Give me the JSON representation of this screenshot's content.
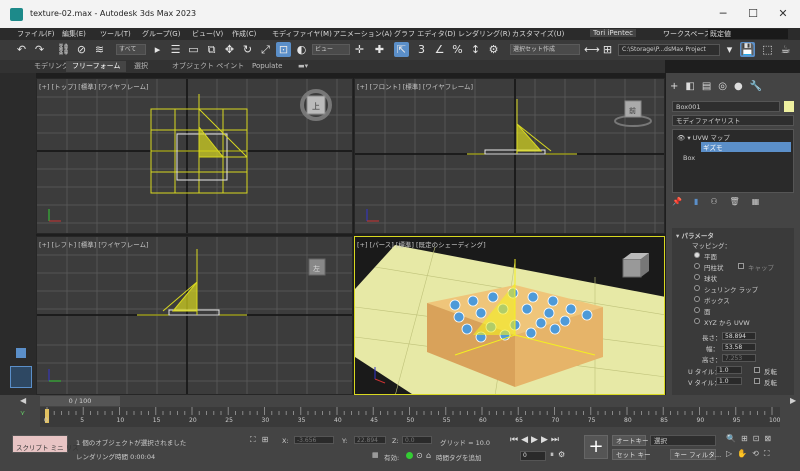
{
  "window": {
    "title": "texture-02.max - Autodesk 3ds Max 2023",
    "min_icon": "minimize-icon",
    "max_icon": "maximize-icon",
    "close_icon": "close-icon"
  },
  "menu": [
    "ファイル(F)",
    "編集(E)",
    "ツール(T)",
    "グループ(G)",
    "ビュー(V)",
    "作成(C)",
    "モディファイヤ(M)",
    "アニメーション(A)",
    "グラフ エディタ(D)",
    "レンダリング(R)",
    "カスタマイズ(U)"
  ],
  "user": {
    "name": "Tori iPentec",
    "workspace_label": "ワークスペース:",
    "workspace_value": "既定値"
  },
  "toolbar": {
    "selection_filter": "すべて",
    "ref_coord": "ビュー",
    "named_sel": "選択セット作成",
    "project_path": "C:\\Storage\\P...dsMax Project"
  },
  "ribbon_tabs": [
    "モデリング",
    "フリーフォーム",
    "選択",
    "オブジェクト ペイント",
    "Populate"
  ],
  "viewports": {
    "top": "[+] [トップ] [標準] [ワイヤフレーム]",
    "front": "[+] [フロント] [標準] [ワイヤフレーム]",
    "left": "[+] [レフト] [標準] [ワイヤフレーム]",
    "persp": "[+] [パース] [標準] [既定のシェーディング]",
    "cube_top": "上",
    "cube_front": "前",
    "cube_left": "左"
  },
  "command_panel": {
    "object_name": "Box001",
    "modifier_list": "モディファイヤリスト",
    "stack": [
      "UVW マップ",
      "ギズモ",
      "Box"
    ],
    "rollout": "パラメータ",
    "mapping_label": "マッピング：",
    "mapping_options": [
      "平面",
      "円柱状",
      "球状",
      "シュリンク ラップ",
      "ボックス",
      "面",
      "XYZ から UVW"
    ],
    "cap_label": "キャップ",
    "length_label": "長さ：",
    "length": "58.894",
    "width_label": "幅：",
    "width": "53.58",
    "height_label": "高さ：",
    "height": "7.253",
    "u_tile_label": "U タイル：",
    "u_tile": "1.0",
    "v_tile_label": "V タイル：",
    "v_tile": "1.0",
    "flip_label": "反転"
  },
  "timeline": {
    "frame": "0 / 100",
    "ticks": [
      "0",
      "5",
      "10",
      "15",
      "20",
      "25",
      "30",
      "35",
      "40",
      "45",
      "50",
      "55",
      "60",
      "65",
      "70",
      "75",
      "80",
      "85",
      "90",
      "95",
      "100"
    ]
  },
  "status": {
    "script_label": "スクリプト ミニ リス",
    "message": "1 個のオブジェクトが選択されました",
    "render_time": "レンダリング時間  0:00:04",
    "x_label": "X:",
    "x": "-3.656",
    "y_label": "Y:",
    "y": "22.894",
    "z_label": "Z:",
    "z": "0.0",
    "grid": "グリッド = 10.0",
    "enabled": "有効:",
    "add_time_tag": "時間タグを追加",
    "frame_field": "0",
    "auto_key": "オートキー",
    "selection": "選択",
    "set_key": "セット キー",
    "key_filter": "キー フィルタ..."
  },
  "colors": {
    "accent": "#5b8fc9",
    "gizmo": "#d8d820",
    "grid": "#555555",
    "persp_bg": "#1a1a1a"
  }
}
